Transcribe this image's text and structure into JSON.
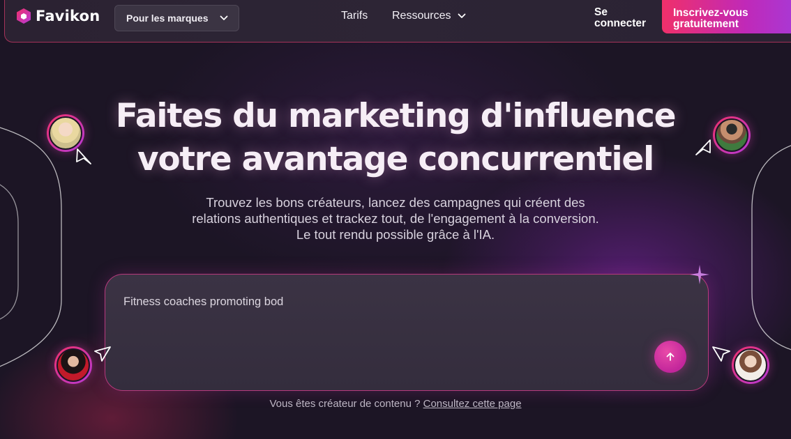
{
  "brand": {
    "name": "Favikon",
    "icon": "hexagon-logo-icon",
    "accent": "#f0306a",
    "accent2": "#b63ad8"
  },
  "nav": {
    "audience_select": "Pour les marques",
    "pricing": "Tarifs",
    "resources": "Ressources",
    "login": "Se connecter",
    "signup": "Inscrivez-vous gratuitement"
  },
  "hero": {
    "headline_line1": "Faites du marketing d'influence",
    "headline_line2": "votre avantage concurrentiel",
    "subtitle_line1": "Trouvez les bons créateurs, lancez des campagnes qui créent des",
    "subtitle_line2": "relations authentiques et trackez tout, de l'engagement à la conversion.",
    "subtitle_line3": "Le tout rendu possible grâce à l'IA."
  },
  "prompt": {
    "value": "Fitness coaches promoting bod",
    "send_icon": "arrow-up-icon"
  },
  "footer_line": {
    "text": "Vous êtes créateur de contenu ?",
    "link": "Consultez cette page"
  }
}
